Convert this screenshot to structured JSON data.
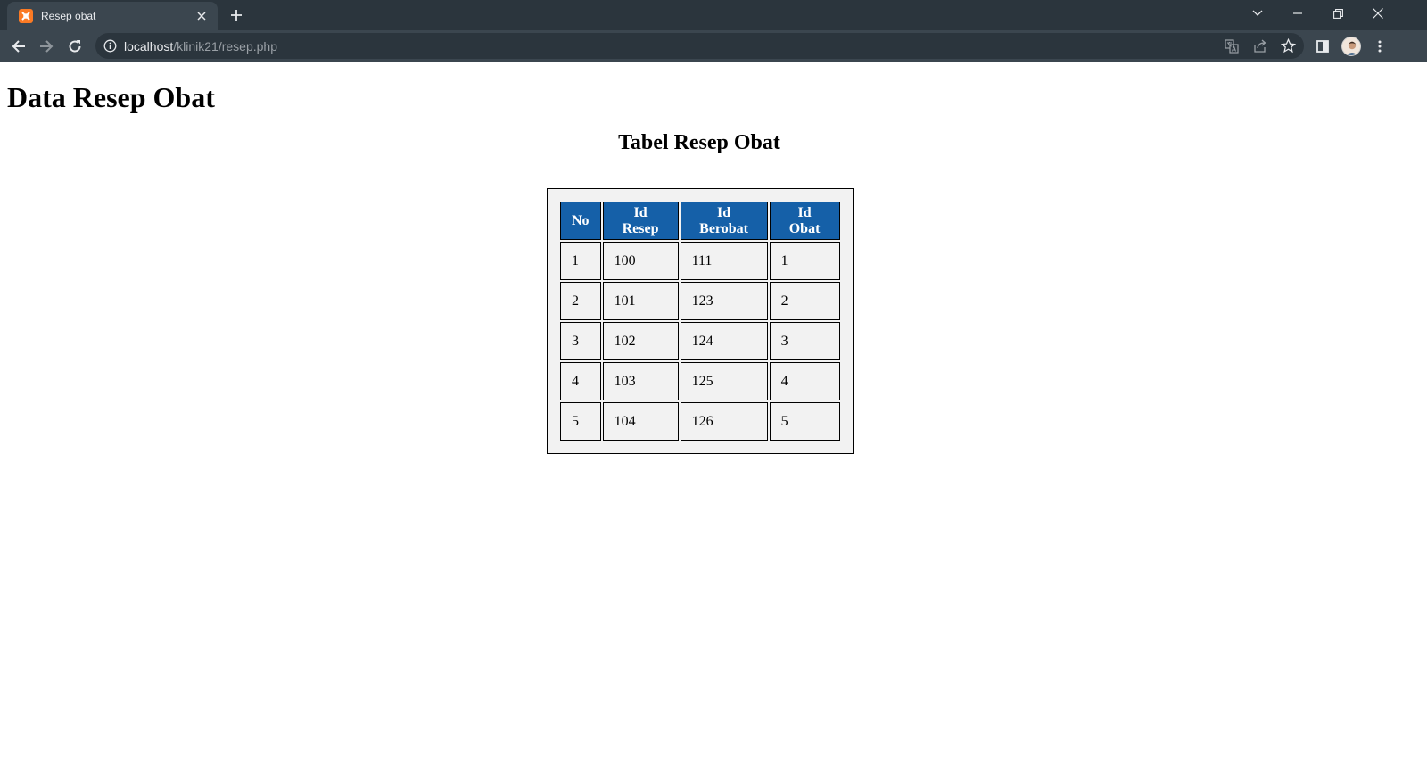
{
  "browser": {
    "tab_title": "Resep obat",
    "url_host": "localhost",
    "url_path": "/klinik21/resep.php",
    "accent_color": "#fb7a24"
  },
  "page": {
    "heading": "Data Resep Obat",
    "table_title": "Tabel Resep Obat",
    "header_color": "#1560a8"
  },
  "table": {
    "headers": [
      "No",
      "Id Resep",
      "Id Berobat",
      "Id Obat"
    ],
    "rows": [
      [
        "1",
        "100",
        "111",
        "1"
      ],
      [
        "2",
        "101",
        "123",
        "2"
      ],
      [
        "3",
        "102",
        "124",
        "3"
      ],
      [
        "4",
        "103",
        "125",
        "4"
      ],
      [
        "5",
        "104",
        "126",
        "5"
      ]
    ]
  }
}
